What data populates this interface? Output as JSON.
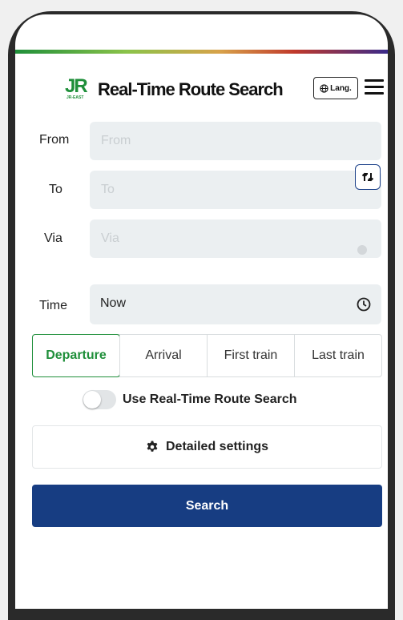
{
  "header": {
    "logo_jr": "JR",
    "logo_east": "JR-EAST",
    "title": "Real-Time Route Search",
    "lang_label": "Lang.",
    "icons": {
      "globe": "globe-icon",
      "menu": "hamburger-menu-icon"
    }
  },
  "form": {
    "from_label": "From",
    "from_placeholder": "From",
    "to_label": "To",
    "to_placeholder": "To",
    "via_label": "Via",
    "via_placeholder": "Via",
    "time_label": "Time",
    "time_value": "Now"
  },
  "tabs": [
    {
      "label": "Departure",
      "active": true
    },
    {
      "label": "Arrival",
      "active": false
    },
    {
      "label": "First train",
      "active": false
    },
    {
      "label": "Last train",
      "active": false
    }
  ],
  "realtime_toggle": {
    "label": "Use Real-Time Route Search",
    "on": false
  },
  "detailed_settings": {
    "label": "Detailed settings"
  },
  "search_button": {
    "label": "Search"
  },
  "colors": {
    "brand_green": "#1f8f3a",
    "navy": "#173d82",
    "field_bg": "#ebeff1"
  }
}
